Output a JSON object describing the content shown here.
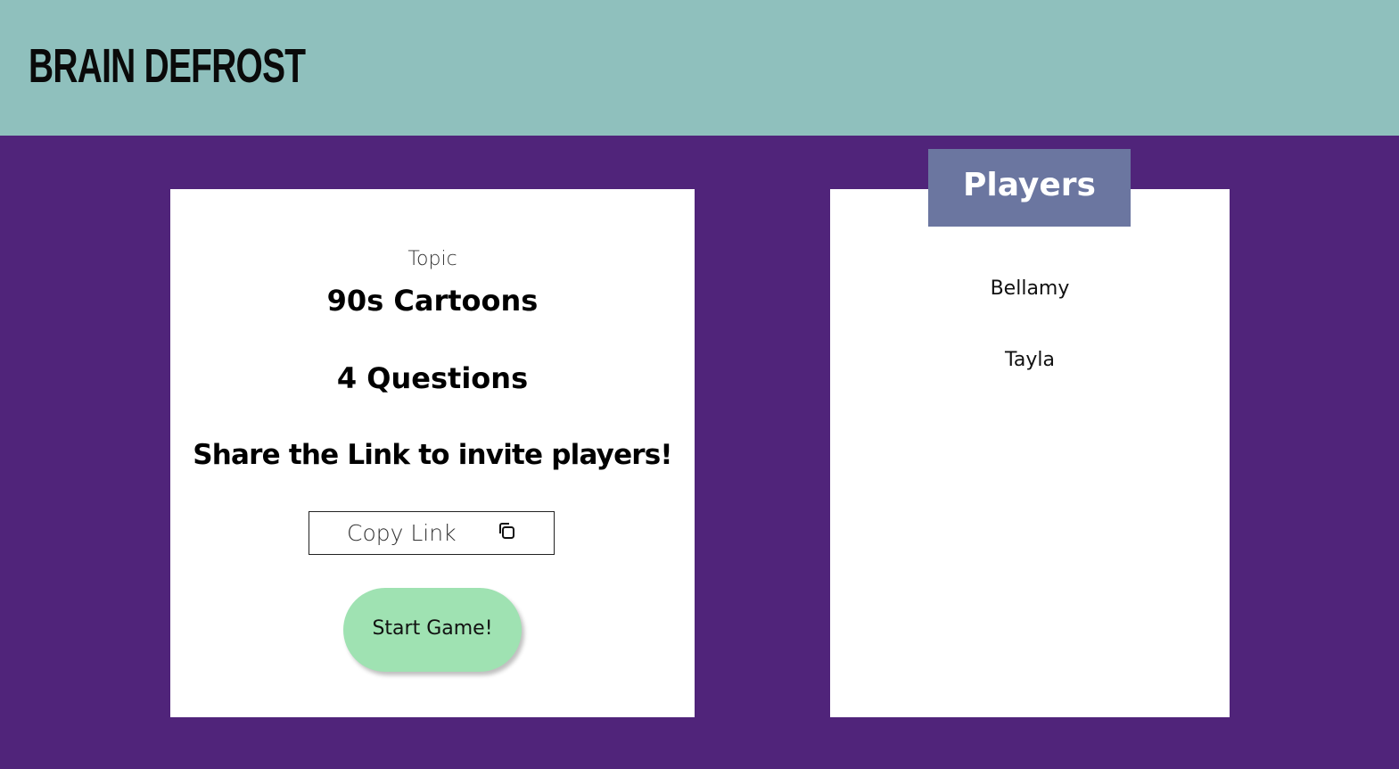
{
  "app": {
    "title": "BRAIN DEFROST"
  },
  "lobby": {
    "topic_label": "Topic",
    "topic_name": "90s Cartoons",
    "question_count": "4 Questions",
    "invite_text": "Share the Link to invite players!",
    "copy_link_label": "Copy Link",
    "copy_icon": "copy-icon",
    "start_label": "Start Game!"
  },
  "players": {
    "title": "Players",
    "list": [
      "Bellamy",
      "Tayla"
    ]
  },
  "colors": {
    "header_bg": "#8fc0bd",
    "page_bg": "#50247a",
    "players_header_bg": "#6b76a0",
    "start_button_bg": "#9fe2b2"
  }
}
